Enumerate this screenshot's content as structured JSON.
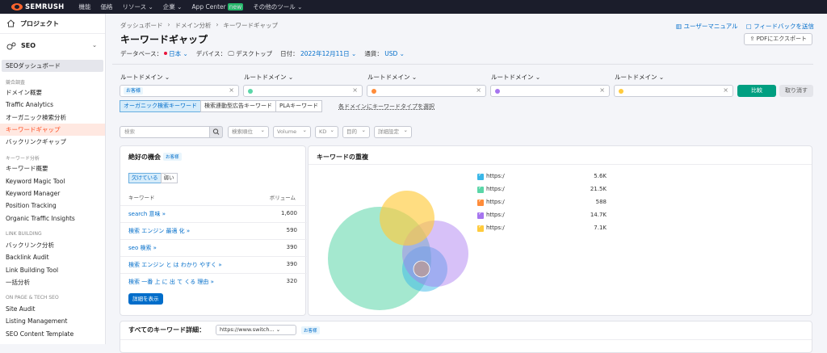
{
  "topbar": {
    "logo": "SEMRUSH",
    "nav": [
      {
        "label": "機能"
      },
      {
        "label": "価格"
      },
      {
        "label": "リソース ⌄"
      },
      {
        "label": "企業 ⌄"
      },
      {
        "label": "App Center",
        "badge": "new"
      },
      {
        "label": "その他のツール ⌄"
      }
    ]
  },
  "sidebar": {
    "project": "プロジェクト",
    "seo": "SEO",
    "dashboard": "SEOダッシュボード",
    "sections": [
      {
        "title": "競合調査",
        "items": [
          "ドメイン概要",
          "Traffic Analytics",
          "オーガニック検索分析",
          "キーワードギャップ",
          "バックリンクギャップ"
        ]
      },
      {
        "title": "キーワード分析",
        "items": [
          "キーワード概要",
          "Keyword Magic Tool",
          "Keyword Manager",
          "Position Tracking",
          "Organic Traffic Insights"
        ]
      },
      {
        "title": "LINK BUILDING",
        "items": [
          "バックリンク分析",
          "Backlink Audit",
          "Link Building Tool",
          "一括分析"
        ]
      },
      {
        "title": "ON PAGE & TECH SEO",
        "items": [
          "Site Audit",
          "Listing Management",
          "SEO Content Template"
        ]
      }
    ],
    "active": "キーワードギャップ"
  },
  "header": {
    "breadcrumbs": [
      "ダッシュボード",
      "›",
      "ドメイン分析",
      "›",
      "キーワードギャップ"
    ],
    "title": "キーワードギャップ",
    "database_label": "データベース：",
    "database_value": "日本 ⌄",
    "device_label": "デバイス：",
    "device_value": "デスクトップ",
    "date_label": "日付：",
    "date_value": "2022年12月11日 ⌄",
    "currency_label": "通貨：",
    "currency_value": "USD ⌄",
    "manual_link": "ユーザーマニュアル",
    "feedback_link": "フィードバックを送信",
    "pdf_button": "PDFにエクスポート"
  },
  "domains": {
    "label": "ルートドメイン ⌄",
    "first_chip": "お客様",
    "colors": [
      "#3ab7e8",
      "#5ad6a8",
      "#ff8c3a",
      "#a675ef",
      "#ffcb3d"
    ],
    "compare_button": "比較",
    "cancel_button": "取り消す"
  },
  "keyword_types": {
    "options": [
      "オーガニック検索キーワード",
      "検索連動型広告キーワード",
      "PLAキーワード"
    ],
    "selected": "オーガニック検索キーワード",
    "link": "各ドメインにキーワードタイプを選択"
  },
  "filters": {
    "search_placeholder": "検索",
    "dropdowns": [
      "検索順位",
      "Volume",
      "KD",
      "目的",
      "詳細設定"
    ]
  },
  "opportunities": {
    "title": "絶好の機会",
    "tag": "お客様",
    "toggle": [
      "欠けている",
      "弱い"
    ],
    "toggle_selected": "欠けている",
    "col_keyword": "キーワード",
    "col_volume": "ボリューム",
    "rows": [
      {
        "keyword": "search 意味 »",
        "volume": "1,600"
      },
      {
        "keyword": "検索 エンジン 最適 化 »",
        "volume": "590"
      },
      {
        "keyword": "seo 検索 »",
        "volume": "390"
      },
      {
        "keyword": "検索 エンジン と は わかり やすく »",
        "volume": "390"
      },
      {
        "keyword": "検索 一番 上 に 出 て くる 理由 »",
        "volume": "320"
      }
    ],
    "details_button": "詳細を表示"
  },
  "overlap": {
    "title": "キーワードの重複",
    "legend": [
      {
        "label": "https:/",
        "value": "5.6K",
        "color": "#3ab7e8"
      },
      {
        "label": "https:/",
        "value": "21.5K",
        "color": "#5ad6a8"
      },
      {
        "label": "https:/",
        "value": "588",
        "color": "#ff8c3a"
      },
      {
        "label": "https:/",
        "value": "14.7K",
        "color": "#a675ef"
      },
      {
        "label": "https:/",
        "value": "7.1K",
        "color": "#ffcb3d"
      }
    ]
  },
  "all_keywords": {
    "label": "すべてのキーワード詳細：",
    "select": "https://www.switch... ⌄",
    "tag": "お客様"
  }
}
